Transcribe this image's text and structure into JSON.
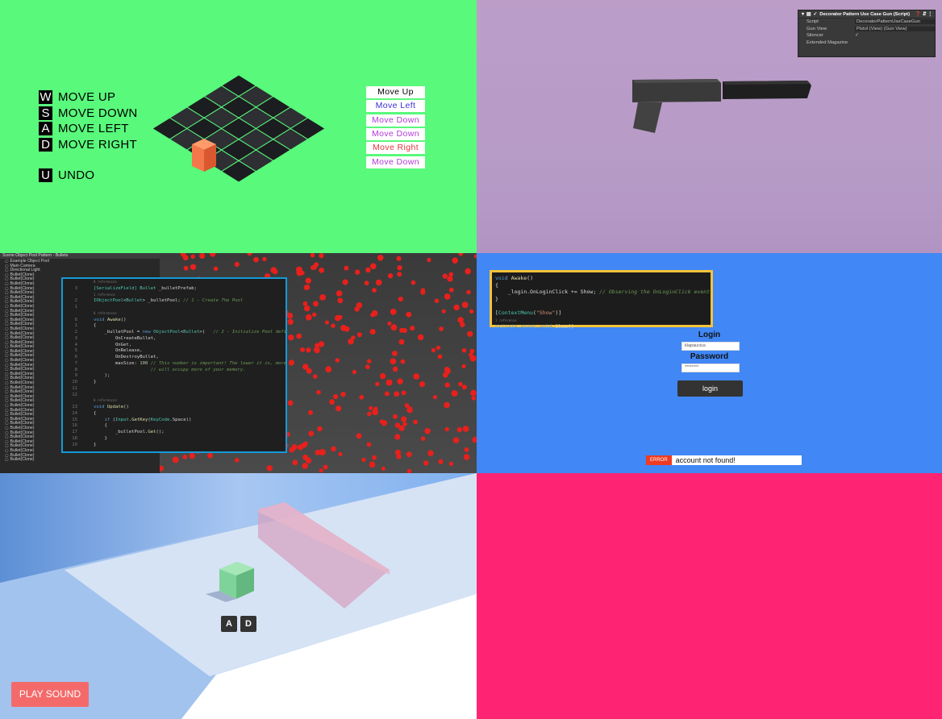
{
  "panel1": {
    "controls": [
      {
        "key": "W",
        "label": "MOVE UP"
      },
      {
        "key": "S",
        "label": "MOVE DOWN"
      },
      {
        "key": "A",
        "label": "MOVE LEFT"
      },
      {
        "key": "D",
        "label": "MOVE RIGHT"
      }
    ],
    "undo": {
      "key": "U",
      "label": "UNDO"
    },
    "history": [
      {
        "label": "Move Up",
        "color": "#000000"
      },
      {
        "label": "Move Left",
        "color": "#3a2fd8"
      },
      {
        "label": "Move Down",
        "color": "#b13ad8"
      },
      {
        "label": "Move Down",
        "color": "#b13ad8"
      },
      {
        "label": "Move Right",
        "color": "#e0363a"
      },
      {
        "label": "Move Down",
        "color": "#b13ad8"
      }
    ]
  },
  "panel2": {
    "inspector": {
      "title": "Decorator Pattern Use Case Gun (Script)",
      "rows": [
        {
          "label": "Script",
          "value": "DecoratorPatternUseCaseGun"
        },
        {
          "label": "Gun View",
          "value": "Pistol (View) (Gun View)"
        },
        {
          "label": "Silencer",
          "value": "✓"
        },
        {
          "label": "Extended Magazine",
          "value": ""
        }
      ]
    }
  },
  "panel3": {
    "hierarchy_title": "Scene Object Pool Pattern - Bullets",
    "hierarchy_items": [
      "Example Object Pool",
      "Main Camera",
      "Directional Light",
      "Bullet(Clone)",
      "Bullet(Clone)",
      "Bullet(Clone)",
      "Bullet(Clone)",
      "Bullet(Clone)",
      "Bullet(Clone)",
      "Bullet(Clone)",
      "Bullet(Clone)",
      "Bullet(Clone)",
      "Bullet(Clone)",
      "Bullet(Clone)",
      "Bullet(Clone)",
      "Bullet(Clone)",
      "Bullet(Clone)",
      "Bullet(Clone)",
      "Bullet(Clone)",
      "Bullet(Clone)",
      "Bullet(Clone)",
      "Bullet(Clone)",
      "Bullet(Clone)",
      "Bullet(Clone)",
      "Bullet(Clone)",
      "Bullet(Clone)",
      "Bullet(Clone)",
      "Bullet(Clone)",
      "Bullet(Clone)",
      "Bullet(Clone)",
      "Bullet(Clone)",
      "Bullet(Clone)",
      "Bullet(Clone)",
      "Bullet(Clone)",
      "Bullet(Clone)",
      "Bullet(Clone)",
      "Bullet(Clone)",
      "Bullet(Clone)",
      "Bullet(Clone)",
      "Bullet(Clone)",
      "Bullet(Clone)",
      "Bullet(Clone)",
      "Bullet(Clone)",
      "Bullet(Clone)",
      "Bullet(Clone)"
    ],
    "code_lines": [
      {
        "n": "",
        "html": "<span class='ref'>0 references</span>"
      },
      {
        "n": "3",
        "html": "<span class='at'>[SerializeField]</span> <span class='ty'>Bullet</span> _bulletPrefab;"
      },
      {
        "n": "",
        "html": "<span class='ref'>1 reference</span>"
      },
      {
        "n": "2",
        "html": "<span class='ty'>IObjectPool</span>&lt;<span class='ty'>Bullet</span>&gt; _bulletPool; <span class='cm'>// 1 - Create The Pool</span>"
      },
      {
        "n": "1",
        "html": ""
      },
      {
        "n": "",
        "html": "<span class='ref'>0 references</span>"
      },
      {
        "n": "8",
        "html": "<span class='kw'>void</span> <span class='fn'>Awake</span>()"
      },
      {
        "n": "1",
        "html": "{"
      },
      {
        "n": "2",
        "html": "    _bulletPool = <span class='kw'>new</span> <span class='ty'>ObjectPool</span>&lt;<span class='ty'>Bullet</span>&gt;(   <span class='cm'>// 2 - Initialize Pool defi</span>"
      },
      {
        "n": "3",
        "html": "        OnCreateBullet,"
      },
      {
        "n": "4",
        "html": "        OnGet,"
      },
      {
        "n": "5",
        "html": "        OnRelease,"
      },
      {
        "n": "6",
        "html": "        OnDestroyBullet,"
      },
      {
        "n": "7",
        "html": "        maxSize: <span class='nu'>100</span> <span class='cm'>// This number is important! The lower it is, more</span>"
      },
      {
        "n": "8",
        "html": "                     <span class='cm'>// will occupy more of your memory.</span>"
      },
      {
        "n": "9",
        "html": "    );"
      },
      {
        "n": "10",
        "html": "}"
      },
      {
        "n": "11",
        "html": ""
      },
      {
        "n": "12",
        "html": ""
      },
      {
        "n": "",
        "html": "<span class='ref'>0 references</span>"
      },
      {
        "n": "13",
        "html": "<span class='kw'>void</span> <span class='fn'>Update</span>()"
      },
      {
        "n": "14",
        "html": "{"
      },
      {
        "n": "15",
        "html": "    <span class='kw'>if</span> (<span class='ty'>Input</span>.<span class='fn'>GetKey</span>(<span class='ty'>KeyCode</span>.Space))"
      },
      {
        "n": "16",
        "html": "    {"
      },
      {
        "n": "17",
        "html": "        _bulletPool.<span class='fn'>Get</span>();"
      },
      {
        "n": "18",
        "html": "    }"
      },
      {
        "n": "19",
        "html": "}"
      }
    ]
  },
  "panel4": {
    "code_lines": [
      "<span class='kw'>void</span> <span class='fn'>Awake</span>()",
      "{",
      "    _login.OnLoginClick += Show; <span class='cm'>// Observing the OnLoginClick event</span>",
      "}",
      "",
      "[<span class='ty'>ContextMenu</span>(<span class='st'>\"Show\"</span>)]",
      "<span class='ref'>1 reference</span>",
      "<span class='kw'>private</span> <span class='kw'>async</span> <span class='kw'>void</span> <span class='fn'>Show</span>()"
    ],
    "login_label": "Login",
    "username_value": "klapaucius",
    "password_label": "Password",
    "password_value": "********",
    "login_button": "login",
    "error_tag": "ERROR",
    "error_message": "account not found!"
  },
  "panel5": {
    "keys": [
      "A",
      "D"
    ],
    "play_button": "PLAY SOUND"
  }
}
